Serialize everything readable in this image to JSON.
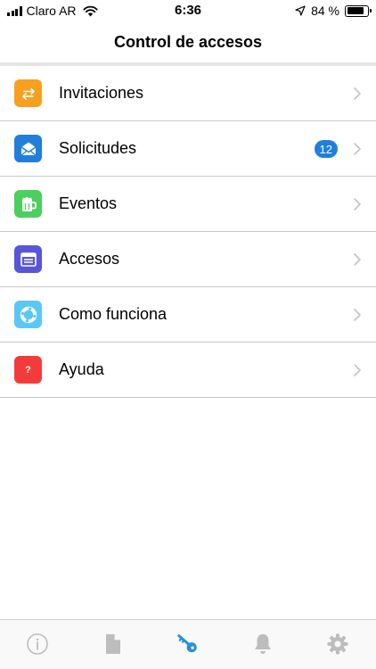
{
  "status_bar": {
    "carrier": "Claro AR",
    "time": "6:36",
    "battery_text": "84 %",
    "battery_level": 0.84
  },
  "navbar": {
    "title": "Control de accesos"
  },
  "menu": {
    "items": [
      {
        "label": "Invitaciones",
        "icon": "arrows-exchange-icon",
        "color": "#f7a01e",
        "badge": ""
      },
      {
        "label": "Solicitudes",
        "icon": "envelope-icon",
        "color": "#1f7fdb",
        "badge": "12"
      },
      {
        "label": "Eventos",
        "icon": "beer-mug-icon",
        "color": "#4ccf5e",
        "badge": ""
      },
      {
        "label": "Accesos",
        "icon": "inbox-tray-icon",
        "color": "#5856d6",
        "badge": ""
      },
      {
        "label": "Como funciona",
        "icon": "lifebuoy-icon",
        "color": "#5ac8f5",
        "badge": ""
      },
      {
        "label": "Ayuda",
        "icon": "question-icon",
        "color": "#f43b3b",
        "badge": ""
      }
    ],
    "question_glyph": "?"
  },
  "tabbar": {
    "tabs": [
      {
        "icon": "info-icon",
        "active": false
      },
      {
        "icon": "document-icon",
        "active": false
      },
      {
        "icon": "key-icon",
        "active": true
      },
      {
        "icon": "bell-icon",
        "active": false
      },
      {
        "icon": "gear-icon",
        "active": false
      }
    ],
    "active_color": "#2b8fd8",
    "inactive_color": "#bdbdbd"
  }
}
